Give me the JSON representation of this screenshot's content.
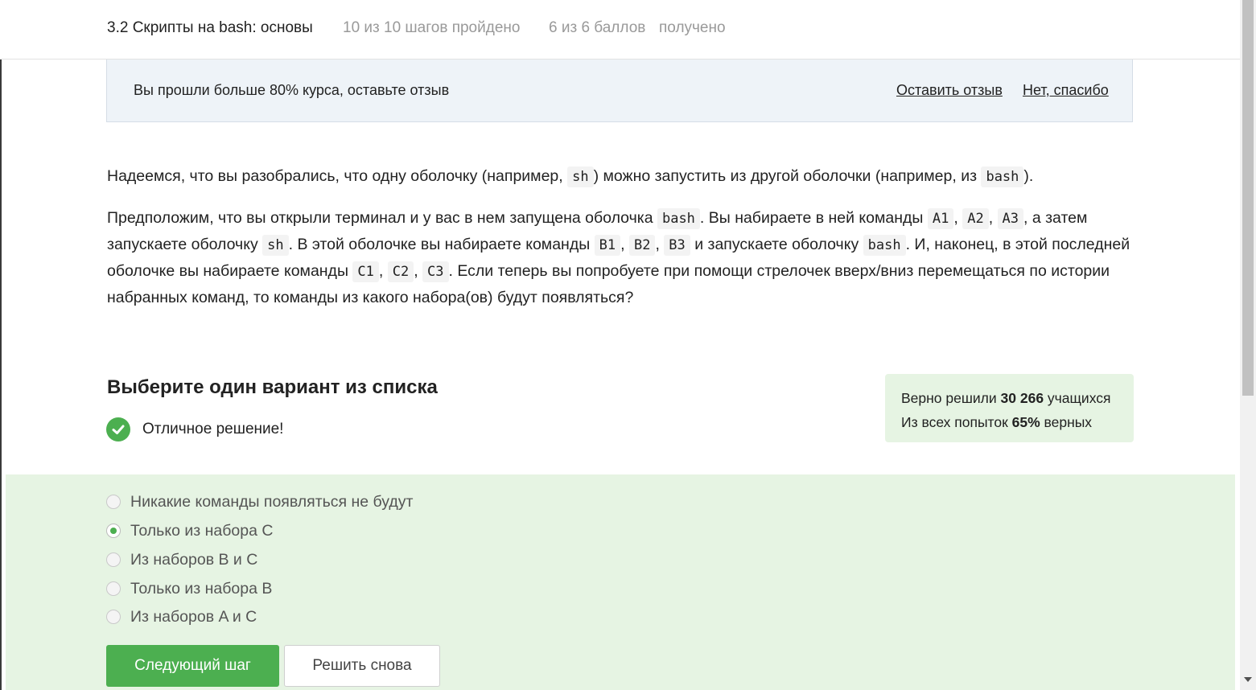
{
  "header": {
    "title": "3.2 Скрипты на bash: основы",
    "steps": "10 из 10 шагов пройдено",
    "points": "6 из 6 баллов",
    "received": "получено"
  },
  "banner": {
    "message": "Вы прошли больше 80% курса, оставьте отзыв",
    "leave_review": "Оставить отзыв",
    "no_thanks": "Нет, спасибо"
  },
  "question": {
    "p1": [
      "Надеемся, что вы разобрались, что одну оболочку (например, ",
      "sh",
      ") можно запустить из другой оболочки (например, из ",
      "bash",
      ")."
    ],
    "p2": [
      "Предположим, что вы открыли терминал и у вас в нем запущена оболочка ",
      "bash",
      ". Вы набираете в ней команды ",
      "A1",
      ", ",
      "A2",
      ", ",
      "A3",
      ", а затем запускаете оболочку ",
      "sh",
      ". В этой оболочке вы набираете команды ",
      "B1",
      ", ",
      "B2",
      ", ",
      "B3",
      " и запускаете оболочку ",
      "bash",
      ". И, наконец, в этой последней оболочке вы набираете команды ",
      "C1",
      ", ",
      "C2",
      ", ",
      "C3",
      ". Если теперь вы попробуете при помощи стрелочек вверх/вниз перемещаться по истории набранных команд, то команды из какого набора(ов) будут появляться?"
    ]
  },
  "quiz": {
    "title": "Выберите один вариант из списка",
    "success": "Отличное решение!",
    "options": [
      {
        "label": "Никакие команды появляться не будут",
        "selected": false
      },
      {
        "label": "Только из набора C",
        "selected": true
      },
      {
        "label": "Из наборов B и C",
        "selected": false
      },
      {
        "label": "Только из набора B",
        "selected": false
      },
      {
        "label": "Из наборов A и C",
        "selected": false
      }
    ],
    "next_button": "Следующий шаг",
    "retry_button": "Решить снова"
  },
  "stats": {
    "solved_prefix": "Верно решили ",
    "solved_count": "30 266",
    "solved_suffix": " учащихся",
    "attempts_prefix": "Из всех попыток ",
    "attempts_percent": "65%",
    "attempts_suffix": " верных"
  },
  "colors": {
    "accent": "#4caf50",
    "answers_bg": "#e6f4e3",
    "banner_bg": "#eef3f8"
  }
}
